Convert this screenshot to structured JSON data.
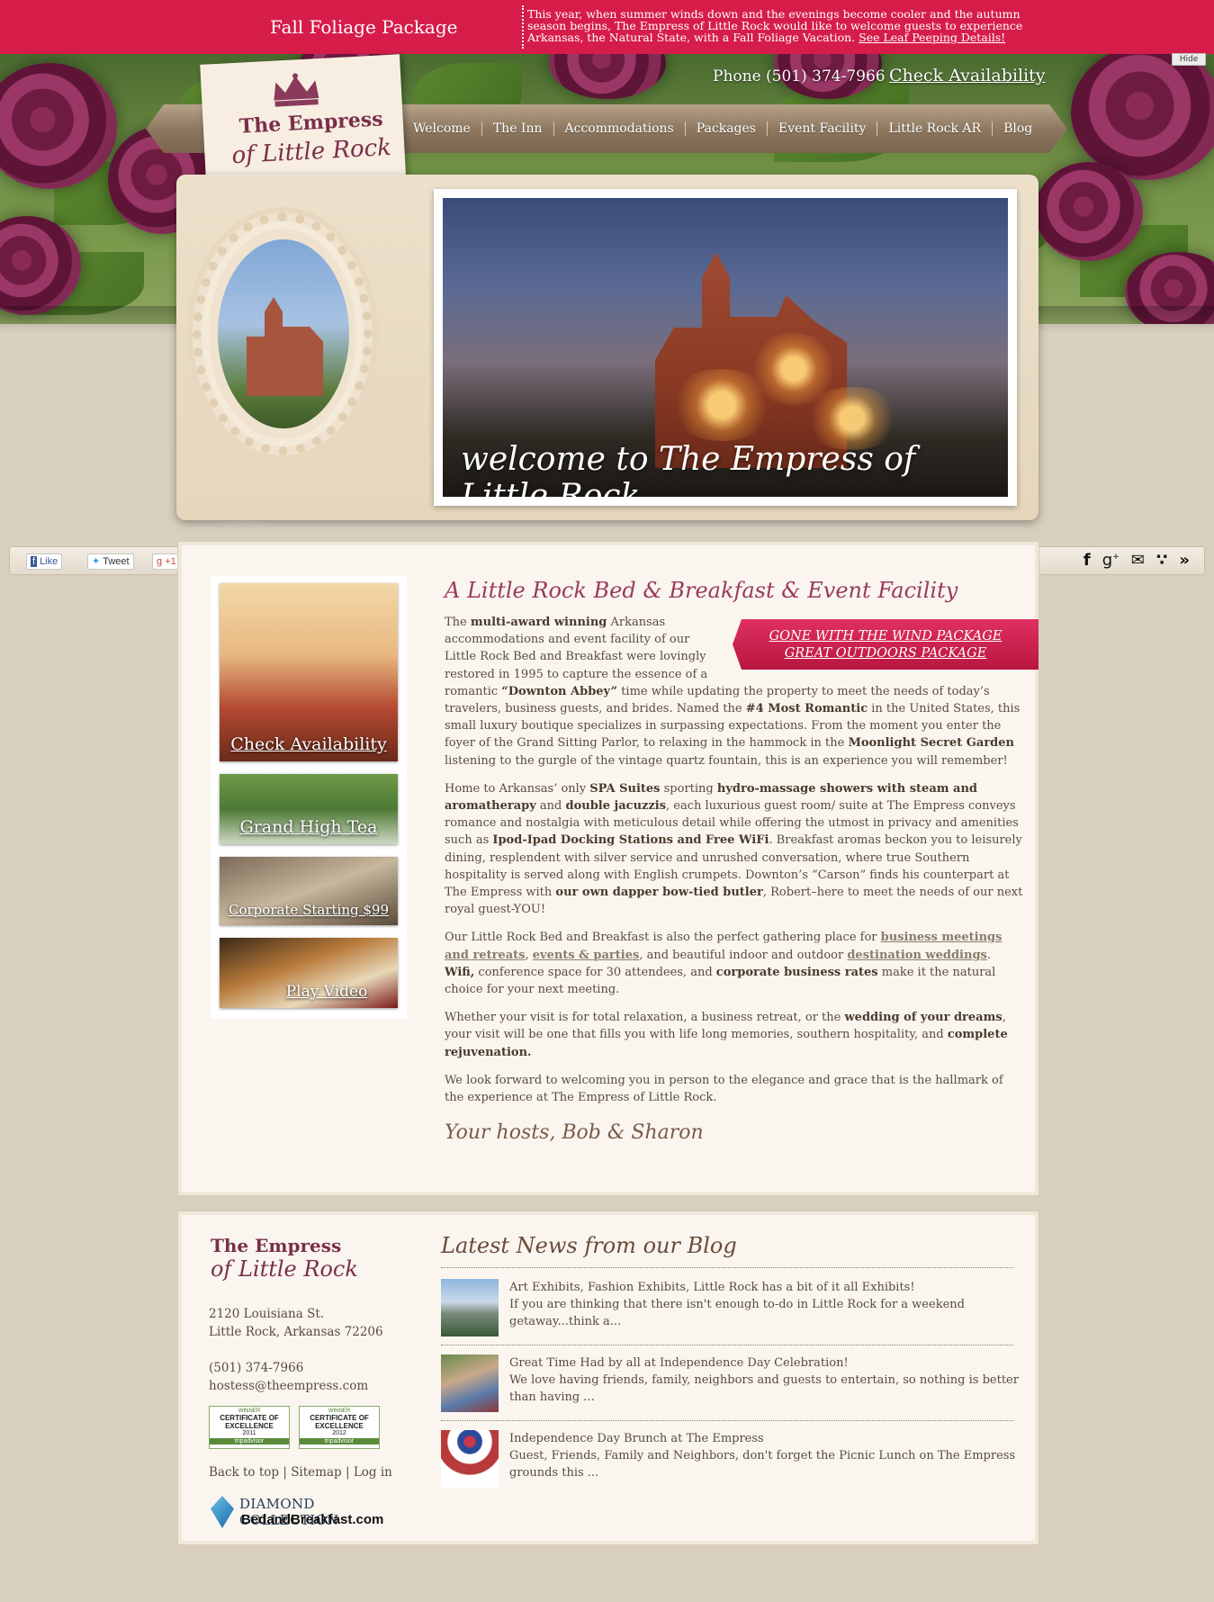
{
  "topbar": {
    "title": "Fall Foliage Package",
    "text": "This year, when summer winds down and the evenings become cooler and the autumn season begins, The Empress of Little Rock would like to welcome guests to experience Arkansas, the Natural State, with a Fall Foliage Vacation.",
    "link": "See Leaf Peeping Details!",
    "hide_label": "Hide"
  },
  "header": {
    "phone": "Phone (501) 374-7966",
    "check_availability": "Check Availability"
  },
  "logo": {
    "line1": "The Empress",
    "line2": "of Little Rock"
  },
  "nav": {
    "items": [
      "Welcome",
      "The Inn",
      "Accommodations",
      "Packages",
      "Event Facility",
      "Little Rock AR",
      "Blog"
    ]
  },
  "hero": {
    "caption": "welcome to The Empress of Little Rock"
  },
  "social": {
    "like": "Like",
    "tweet": "Tweet",
    "plus": "+1",
    "icons": [
      "facebook-icon",
      "google-plus-icon",
      "email-icon",
      "rss-icon",
      "more-icon"
    ]
  },
  "sidebar": {
    "tiles": [
      {
        "label": "Check Availability"
      },
      {
        "label": "Grand High Tea"
      },
      {
        "label": "Corporate Starting $99"
      },
      {
        "label": "Play Video"
      }
    ]
  },
  "main": {
    "title": "A Little Rock Bed & Breakfast & Event Facility",
    "ribbon_links": [
      "GONE WITH THE WIND PACKAGE",
      "GREAT OUTDOORS PACKAGE"
    ],
    "p1_a": "The ",
    "p1_b": "multi-award winning",
    "p1_c": " Arkansas accommodations and event facility of our Little Rock Bed and Breakfast were lovingly restored in 1995 to capture the essence of a romantic ",
    "p1_d": "“Downton Abbey”",
    "p1_e": " time while updating the property to meet the needs of today’s travelers, business guests, and brides.  Named the ",
    "p1_f": "#4 Most Romantic",
    "p1_g": " in the United States, this small luxury boutique  specializes in surpassing expectations.  From the moment you enter the foyer of the Grand Sitting Parlor, to relaxing in the hammock in the ",
    "p1_h": "Moonlight Secret Garden",
    "p1_i": " listening to the gurgle of the vintage quartz fountain, this is an experience you will remember!",
    "p2_a": "Home to Arkansas’ only ",
    "p2_b": "SPA Suites",
    "p2_c": " sporting ",
    "p2_d": "hydro-massage showers with steam and aromatherapy",
    "p2_e": " and ",
    "p2_f": "double jacuzzis",
    "p2_g": ", each luxurious guest room/ suite at The Empress conveys romance and nostalgia with meticulous detail while offering the utmost in privacy and amenities such as ",
    "p2_h": "Ipod-Ipad Docking Stations and Free WiFi",
    "p2_i": ".  Breakfast aromas beckon you to leisurely dining,  resplendent with silver service and unrushed conversation, where true Southern hospitality is served along with English crumpets.  Downton’s “Carson” finds his counterpart at The Empress with ",
    "p2_j": "our own dapper bow-tied butler",
    "p2_k": ", Robert–here to meet the needs of our next royal guest-YOU!",
    "p3_a": "Our Little Rock Bed and Breakfast is also the perfect gathering place for ",
    "p3_link1": "business meetings and retreats",
    "p3_b": ", ",
    "p3_link2": "events & parties",
    "p3_c": ", and beautiful indoor and outdoor ",
    "p3_link3": "destination weddings",
    "p3_d": ". ",
    "p3_e": "Wifi,",
    "p3_f": " conference space for 30 attendees, and ",
    "p3_g": "corporate business rates",
    "p3_h": " make it the natural choice for your next meeting.",
    "p4_a": "Whether your visit is for total relaxation, a business retreat, or the ",
    "p4_b": "wedding of your dreams",
    "p4_c": ", your visit will be one that fills you with life long memories, southern hospitality, and ",
    "p4_d": "complete rejuvenation.",
    "p5": "We look forward to welcoming you in person to the elegance and grace that is the hallmark of the experience at The Empress of Little Rock.",
    "signature": "Your hosts, Bob & Sharon"
  },
  "footer": {
    "logo_line1": "The Empress",
    "logo_line2": "of Little Rock",
    "address1": "2120 Louisiana St.",
    "address2": "Little Rock, Arkansas 72206",
    "phone": "(501) 374-7966",
    "email": "hostess@theempress.com",
    "badges": [
      {
        "winner": "WINNER",
        "title": "CERTIFICATE OF EXCELLENCE",
        "year": "2011",
        "brand": "tripadvisor"
      },
      {
        "winner": "WINNER",
        "title": "CERTIFICATE OF EXCELLENCE",
        "year": "2012",
        "brand": "tripadvisor"
      }
    ],
    "links": [
      "Back to top",
      "Sitemap",
      "Log in"
    ],
    "diamond_line1": "DIAMOND COLLECTION",
    "diamond_line2": "BedandBreakfast.com"
  },
  "blog": {
    "title": "Latest News from our Blog",
    "posts": [
      {
        "title": "Art Exhibits, Fashion Exhibits, Little Rock has a bit of it all Exhibits!",
        "excerpt": "If you are thinking that there isn't enough to-do in Little Rock for a weekend getaway...think a..."
      },
      {
        "title": "Great Time Had by all at Independence Day Celebration!",
        "excerpt": "We love having friends, family, neighbors and guests to entertain, so nothing is better than having ..."
      },
      {
        "title": "Independence Day Brunch at The Empress",
        "excerpt": "Guest, Friends, Family and Neighbors, don't forget the Picnic Lunch on The Empress grounds this ..."
      }
    ]
  },
  "colors": {
    "topbar": "#d61d4a",
    "accent": "#9a3a5a",
    "text": "#5a4a3c"
  }
}
